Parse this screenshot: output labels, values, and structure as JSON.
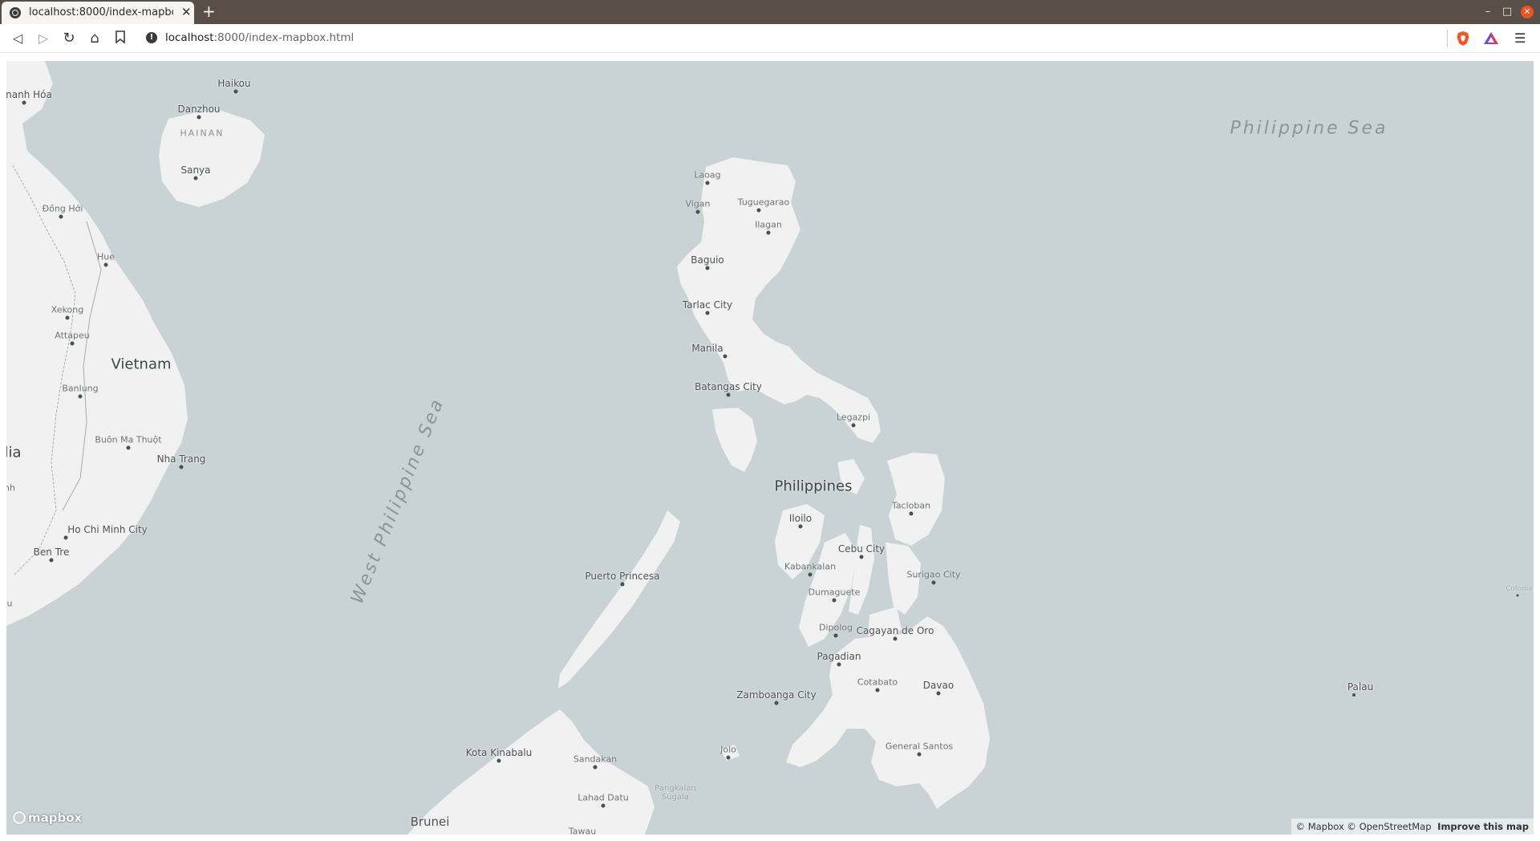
{
  "browser": {
    "tab_title": "localhost:8000/index-mapbox.",
    "url_host": "localhost",
    "url_rest": ":8000/index-mapbox.html",
    "new_tab": "+",
    "close": "✕",
    "back": "◁",
    "forward": "▷",
    "reload": "↻",
    "home": "⌂",
    "bookmark": "⌑",
    "menu": "☰",
    "minimize": "–",
    "maximize": "□",
    "win_close": "✕"
  },
  "map": {
    "colors": {
      "water": "#c9d2d4",
      "land": "#f1f1f1",
      "border": "#9aa0a3"
    },
    "countries": [
      "Vietnam",
      "Philippines",
      "lia"
    ],
    "seas": [
      "Philippine Sea",
      "West Philippine Sea"
    ],
    "islands": [
      "HAINAN"
    ],
    "cities": [
      "Haikou",
      "Danzhou",
      "Sanya",
      "nanh Hóa",
      "Đồng Hới",
      "Hue",
      "Xekong",
      "Attapeu",
      "Banlung",
      "Buôn Ma Thuột",
      "Nha Trang",
      "Ho Chi Minh City",
      "Ben Tre",
      "nh",
      "u",
      "Laoag",
      "Vigan",
      "Tuguegarao",
      "Ilagan",
      "Baguio",
      "Tarlac City",
      "Manila",
      "Batangas City",
      "Legazpi",
      "Iloilo",
      "Tacloban",
      "Cebu City",
      "Kabankalan",
      "Surigao City",
      "Dumaguete",
      "Puerto Princesa",
      "Dipolog",
      "Cagayan de Oro",
      "Pagadian",
      "Cotabato",
      "Davao",
      "Zamboanga City",
      "General Santos",
      "Jolo",
      "Kota Kinabalu",
      "Sandakan",
      "Lahad Datu",
      "Pangkalan Sugala",
      "Brunei",
      "Tawau",
      "Palau",
      "Colonia"
    ],
    "attribution": {
      "mapbox": "© Mapbox",
      "osm": "© OpenStreetMap",
      "improve": "Improve this map"
    },
    "logo": "mapbox"
  }
}
